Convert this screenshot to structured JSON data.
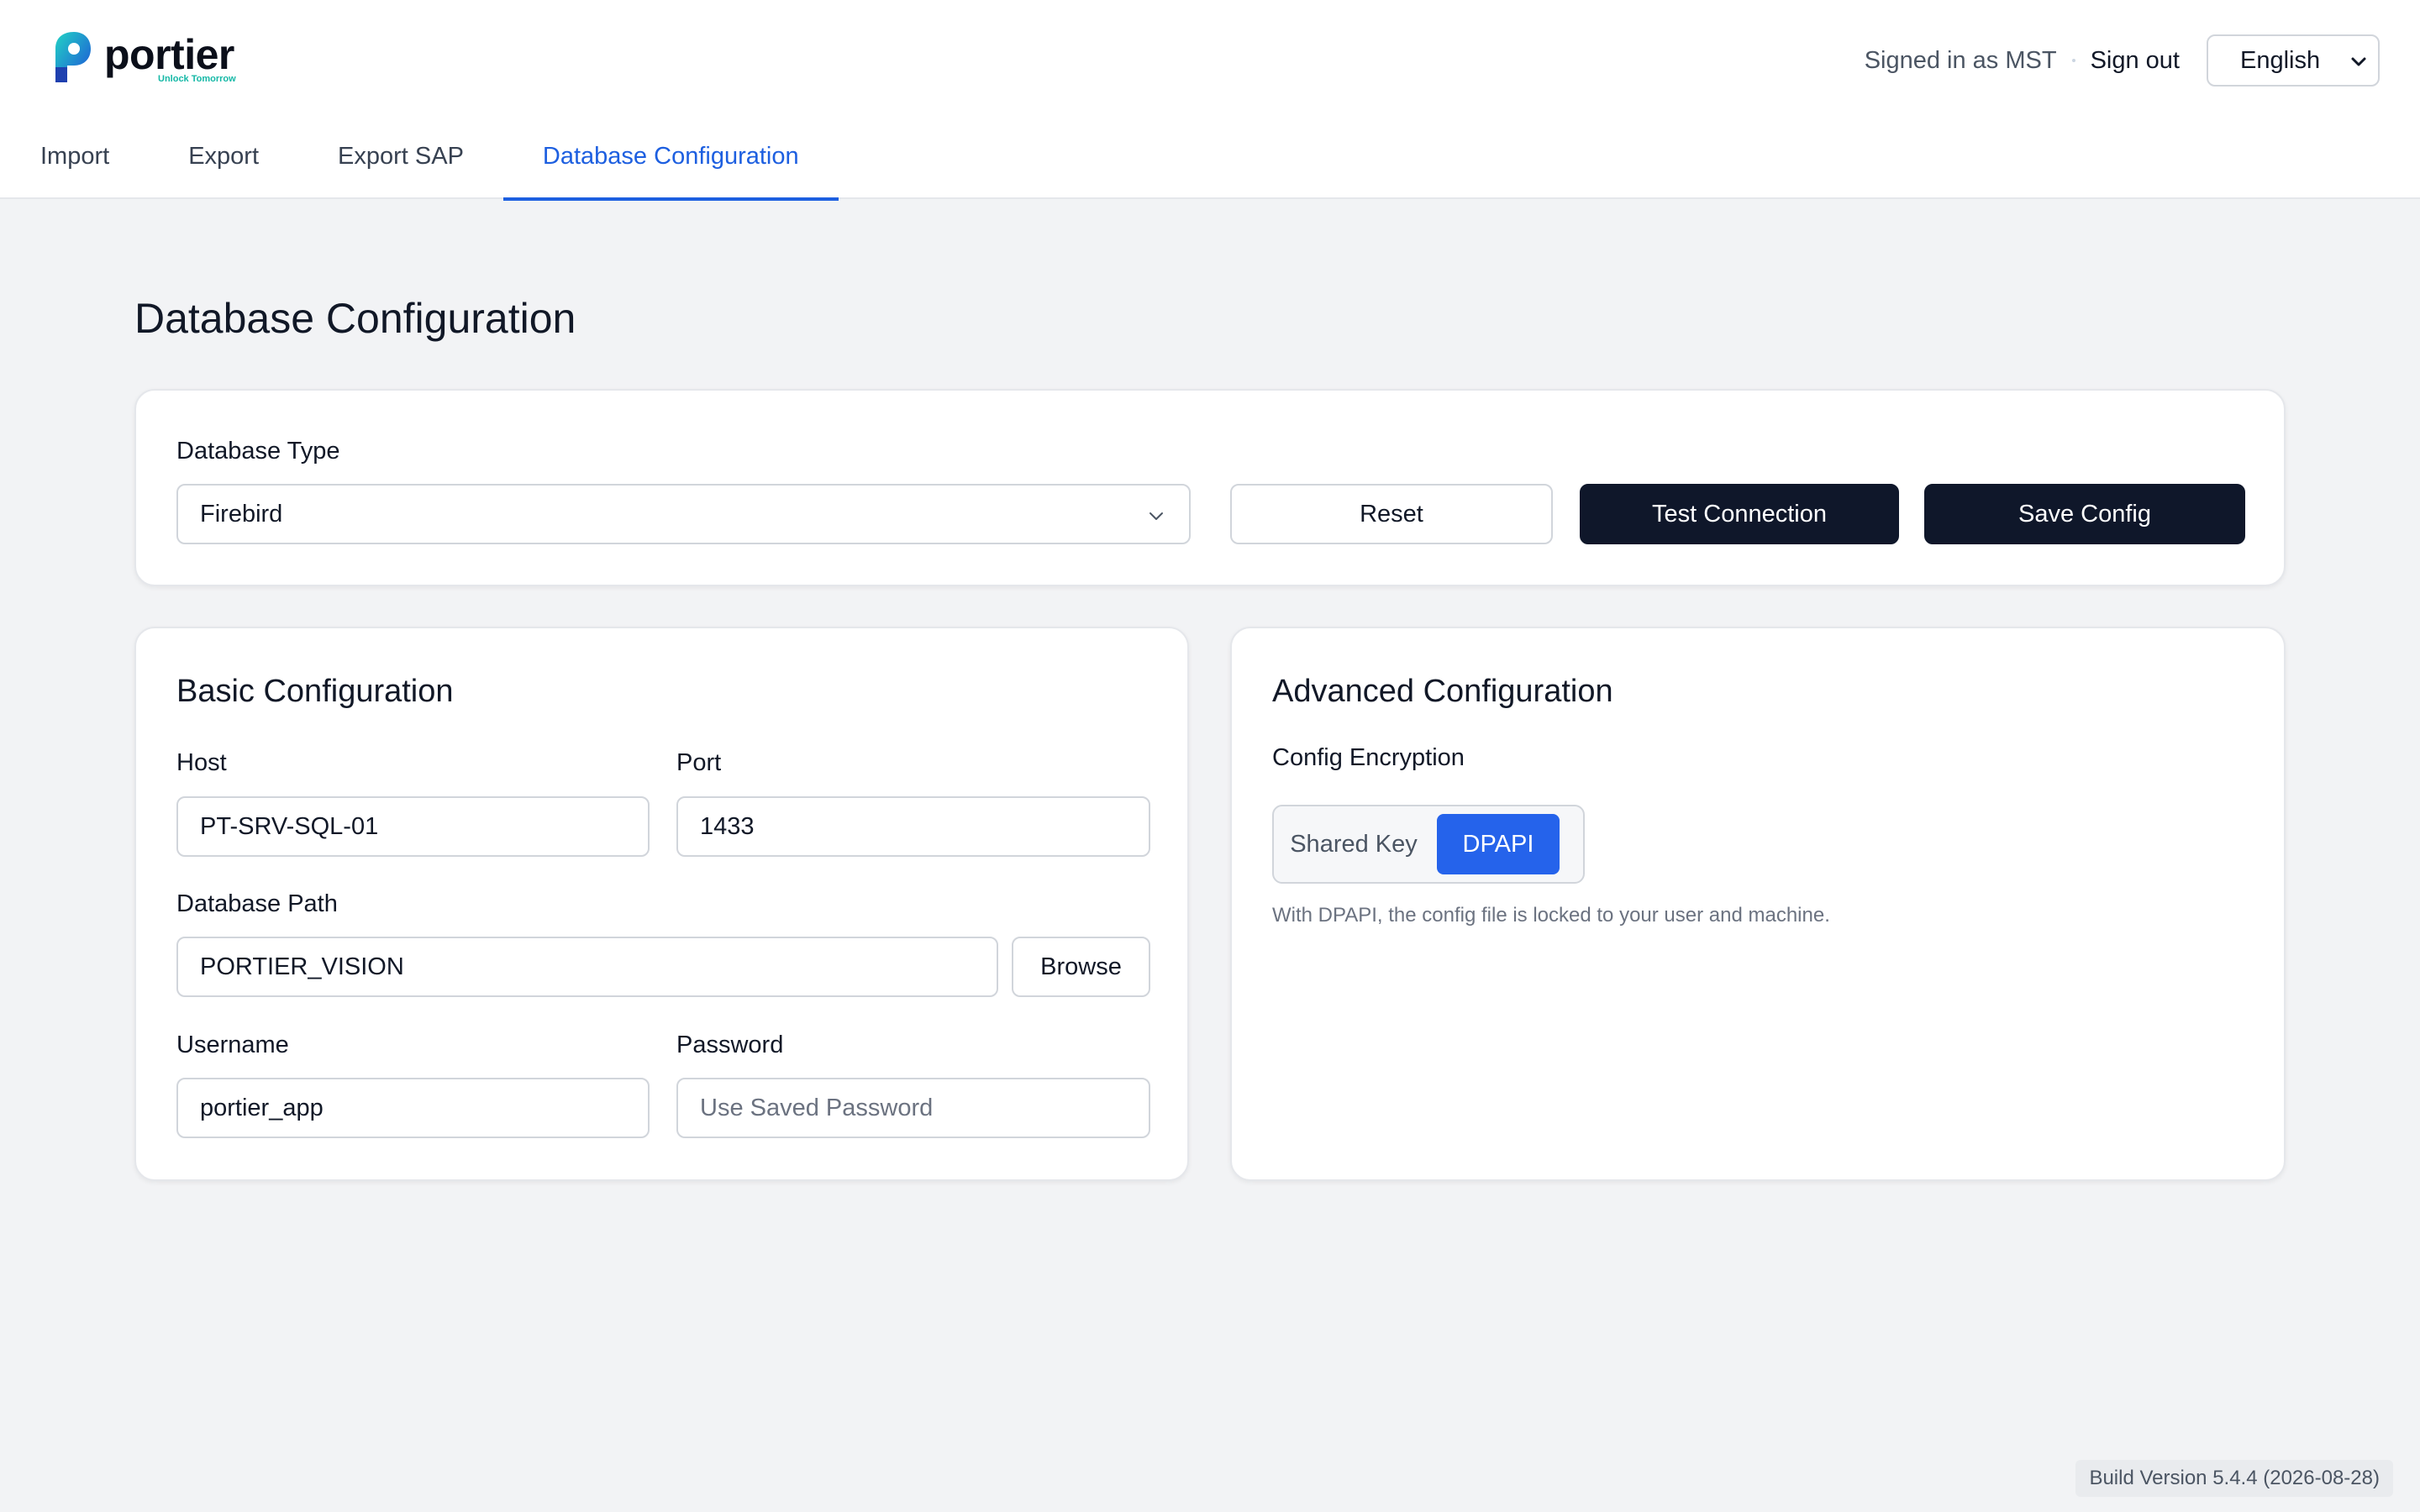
{
  "brand": {
    "name": "portier",
    "tagline": "Unlock Tomorrow",
    "accent": "#1d5fe0"
  },
  "header": {
    "signed_in_text": "Signed in as MST",
    "sign_out_label": "Sign out",
    "language": {
      "selected": "English",
      "icon": "chevron-down-icon"
    }
  },
  "tabs": [
    {
      "label": "Import",
      "active": false
    },
    {
      "label": "Export",
      "active": false
    },
    {
      "label": "Export SAP",
      "active": false
    },
    {
      "label": "Database Configuration",
      "active": true
    }
  ],
  "page": {
    "title": "Database Configuration"
  },
  "db_type": {
    "label": "Database Type",
    "selected": "Firebird",
    "reset_label": "Reset",
    "test_label": "Test Connection",
    "save_label": "Save Config"
  },
  "basic": {
    "title": "Basic Configuration",
    "host_label": "Host",
    "host_value": "PT-SRV-SQL-01",
    "port_label": "Port",
    "port_value": "1433",
    "path_label": "Database Path",
    "path_value": "PORTIER_VISION",
    "browse_label": "Browse",
    "username_label": "Username",
    "username_value": "portier_app",
    "password_label": "Password",
    "password_placeholder": "Use Saved Password"
  },
  "advanced": {
    "title": "Advanced Configuration",
    "encryption_label": "Config Encryption",
    "options": [
      "Shared Key",
      "DPAPI"
    ],
    "selected": "DPAPI",
    "hint": "With DPAPI, the config file is locked to your user and machine."
  },
  "footer": {
    "build": "Build Version 5.4.4 (2026-08-28)"
  }
}
